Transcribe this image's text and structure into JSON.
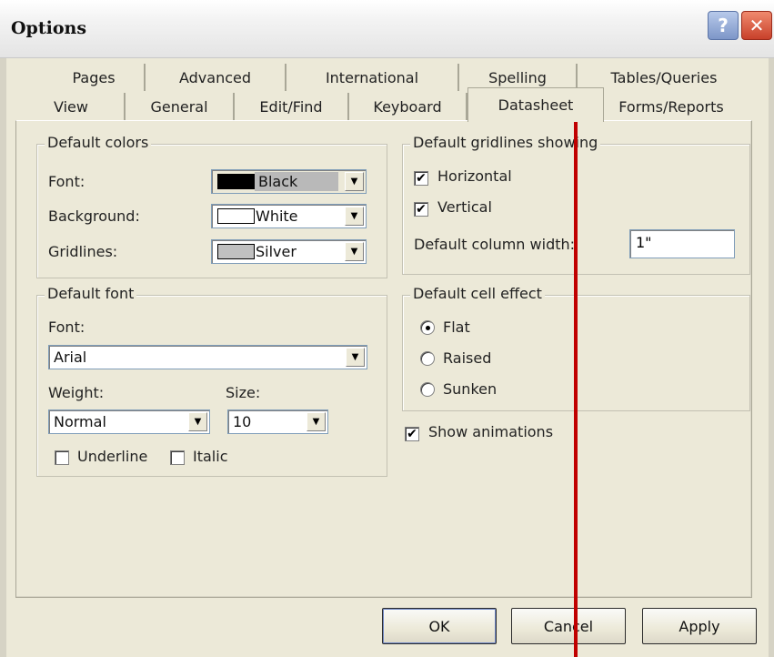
{
  "window": {
    "title": "Options",
    "help_label": "?",
    "close_label": "✕"
  },
  "tabs": {
    "row1": [
      "Pages",
      "Advanced",
      "International",
      "Spelling",
      "Tables/Queries"
    ],
    "row2": [
      "View",
      "General",
      "Edit/Find",
      "Keyboard",
      "Datasheet",
      "Forms/Reports"
    ],
    "selected": "Datasheet"
  },
  "default_colors": {
    "title": "Default colors",
    "font_label": "Font:",
    "font_value": "Black",
    "font_swatch": "#000000",
    "background_label": "Background:",
    "background_value": "White",
    "background_swatch": "#ffffff",
    "gridlines_label": "Gridlines:",
    "gridlines_value": "Silver",
    "gridlines_swatch": "#c0c0c0"
  },
  "default_font": {
    "title": "Default font",
    "font_label": "Font:",
    "font_value": "Arial",
    "weight_label": "Weight:",
    "weight_value": "Normal",
    "size_label": "Size:",
    "size_value": "10",
    "underline_label": "Underline",
    "underline_checked": false,
    "italic_label": "Italic",
    "italic_checked": false
  },
  "gridlines": {
    "title": "Default gridlines showing",
    "horizontal_label": "Horizontal",
    "horizontal_checked": true,
    "vertical_label": "Vertical",
    "vertical_checked": true,
    "column_width_label": "Default column width:",
    "column_width_value": "1\""
  },
  "cell_effect": {
    "title": "Default cell effect",
    "options": [
      "Flat",
      "Raised",
      "Sunken"
    ],
    "selected": "Flat"
  },
  "show_animations": {
    "label": "Show animations",
    "checked": true
  },
  "buttons": {
    "ok": "OK",
    "cancel": "Cancel",
    "apply": "Apply"
  },
  "check_mark": "✔",
  "dropdown_glyph": "▼",
  "colors": {
    "annotation_arrow": "#c00000",
    "dialog_face": "#ece9d8"
  }
}
